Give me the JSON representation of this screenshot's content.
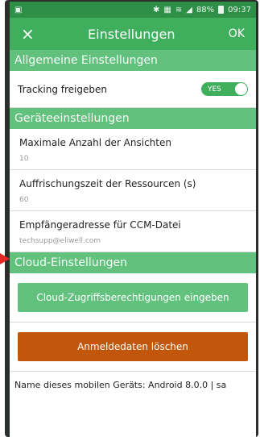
{
  "status_bar": {
    "battery": "88%",
    "time": "09:37",
    "icons": [
      "app-icon",
      "bluetooth-icon",
      "nfc-icon",
      "wifi-icon",
      "signal-icon",
      "battery-icon"
    ]
  },
  "app_bar": {
    "close_symbol": "×",
    "title": "Einstellungen",
    "ok_label": "OK"
  },
  "sections": {
    "general": {
      "header": "Allgemeine Einstellungen",
      "tracking_label": "Tracking freigeben",
      "tracking_toggle": "YES"
    },
    "device": {
      "header": "Geräteeinstellungen",
      "max_views_label": "Maximale Anzahl der Ansichten",
      "max_views_value": "10",
      "refresh_label": "Auffrischungszeit der Ressourcen (s)",
      "refresh_value": "60",
      "recipient_label": "Empfängeradresse für CCM-Datei",
      "recipient_value": "techsupp@eliwell.com"
    },
    "cloud": {
      "header": "Cloud-Einstellungen",
      "credentials_button": "Cloud-Zugriffsberechtigungen eingeben",
      "delete_button": "Anmeldedaten löschen"
    }
  },
  "device_name": "Name dieses mobilen Geräts: Android 8.0.0 | sa",
  "colors": {
    "status_bar": "#2e8f47",
    "app_bar": "#3fae5d",
    "section_header": "#63c17e",
    "delete_button": "#c2560a",
    "pointer": "#e32626"
  }
}
